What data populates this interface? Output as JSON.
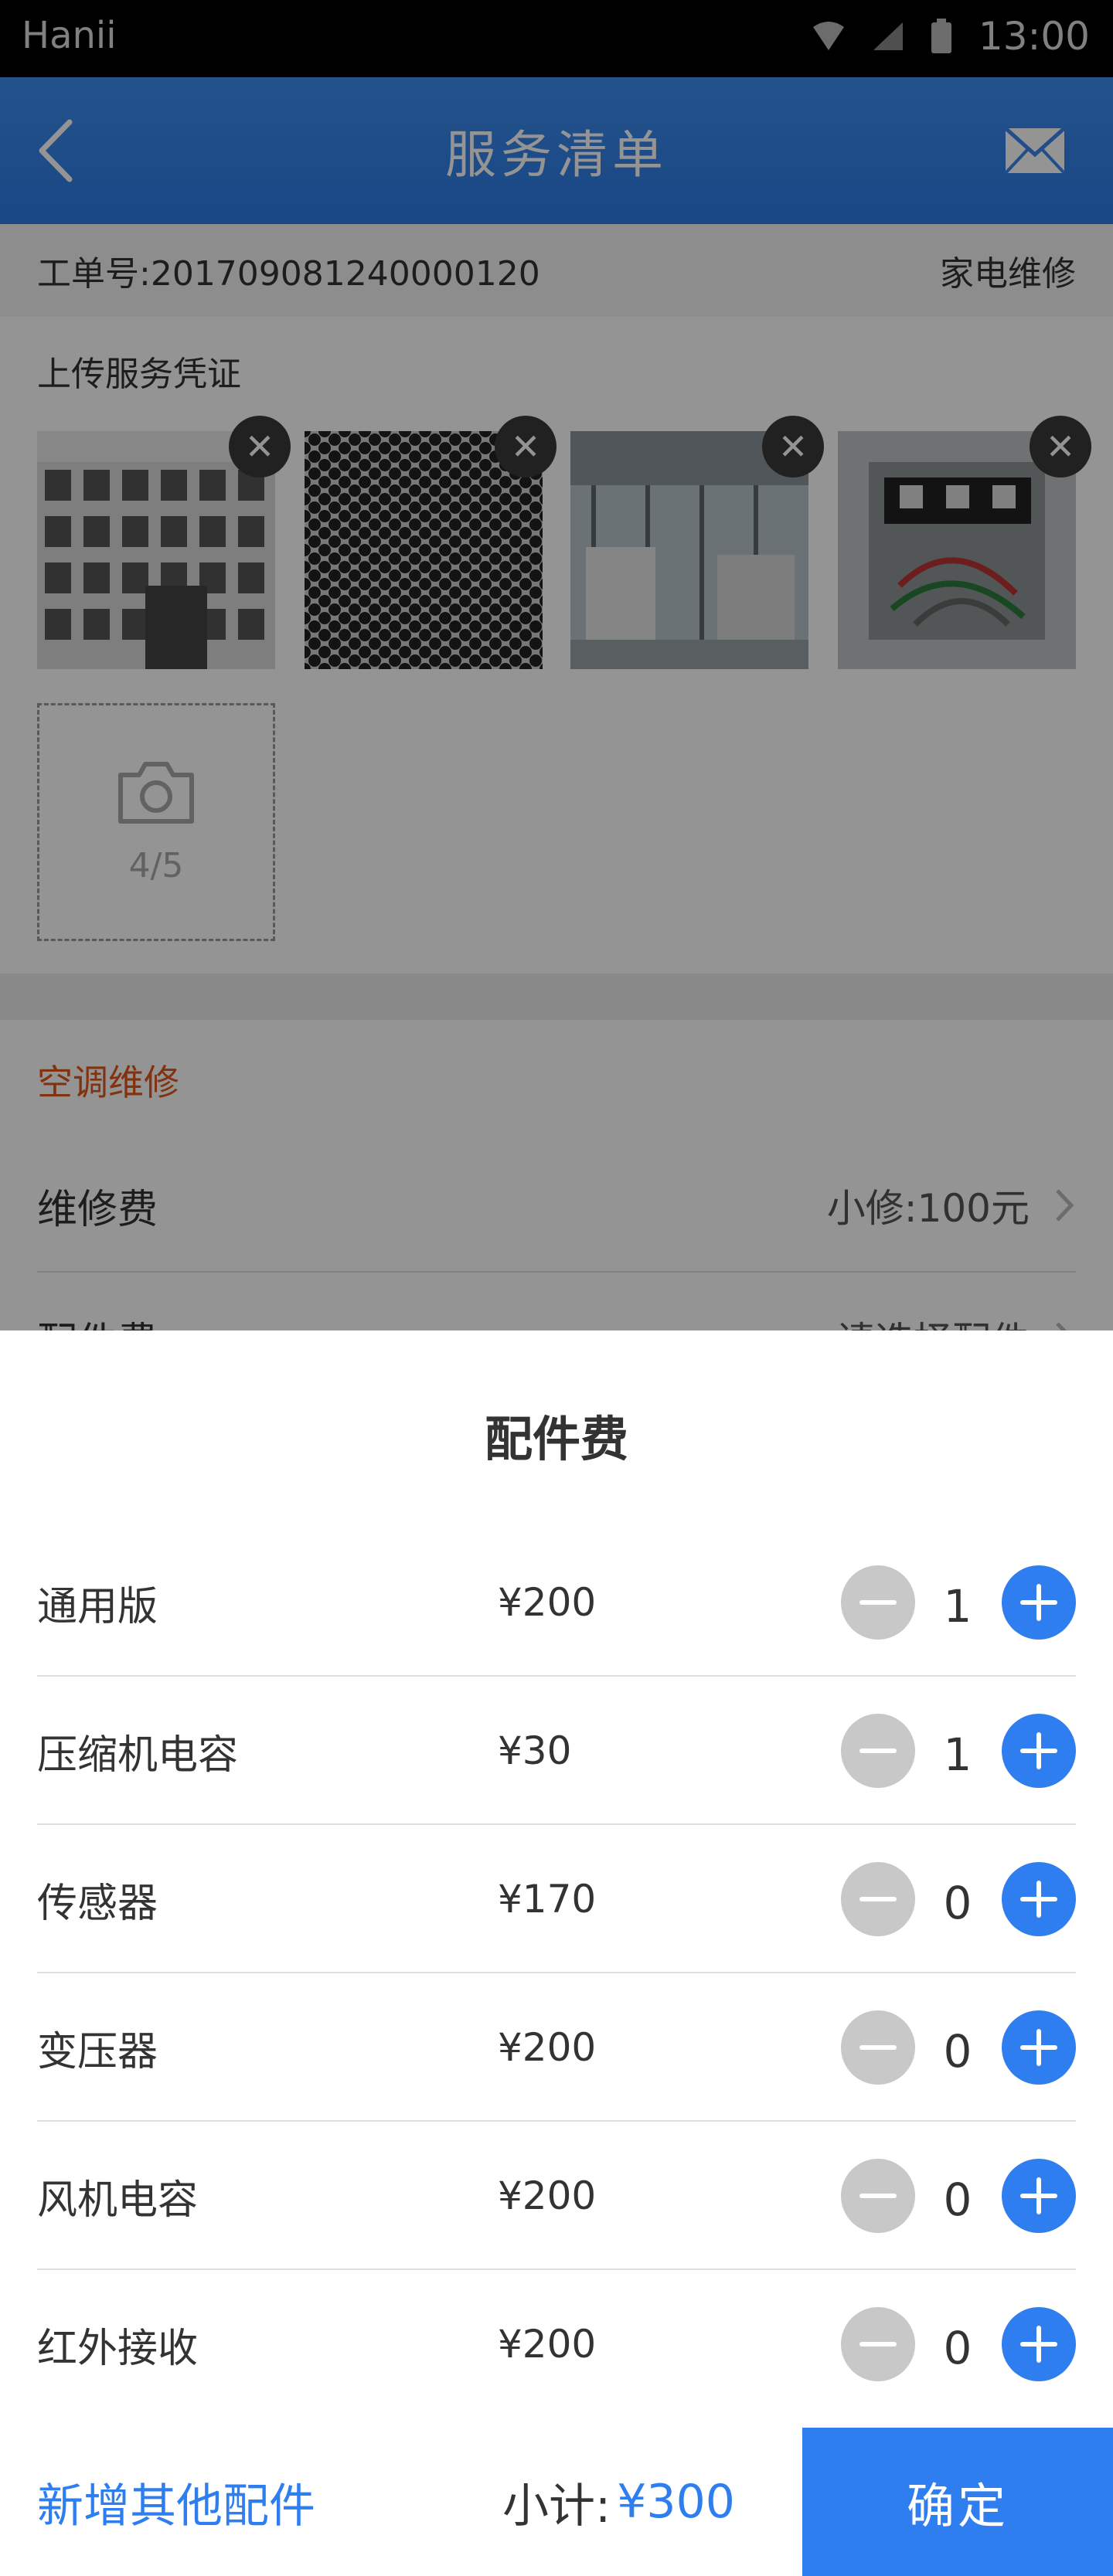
{
  "status_bar": {
    "carrier": "Hanii",
    "time": "13:00"
  },
  "nav": {
    "title": "服务清单"
  },
  "order": {
    "label": "工单号:",
    "number": "201709081240000120",
    "type": "家电维修"
  },
  "upload": {
    "title": "上传服务凭证",
    "photo_count": "4/5",
    "close_glyph": "✕",
    "photos": [
      "building-facade",
      "perforated-metal",
      "ac-units-storefront",
      "electrical-box"
    ]
  },
  "category": {
    "label": "空调维修"
  },
  "fees": [
    {
      "label": "维修费",
      "value": "小修:100元"
    },
    {
      "label": "配件费",
      "value": "请选择配件"
    }
  ],
  "sheet": {
    "title": "配件费",
    "parts": [
      {
        "name": "通用版",
        "price": "¥200",
        "qty": "1"
      },
      {
        "name": "压缩机电容",
        "price": "¥30",
        "qty": "1"
      },
      {
        "name": "传感器",
        "price": "¥170",
        "qty": "0"
      },
      {
        "name": "变压器",
        "price": "¥200",
        "qty": "0"
      },
      {
        "name": "风机电容",
        "price": "¥200",
        "qty": "0"
      },
      {
        "name": "红外接收",
        "price": "¥200",
        "qty": "0"
      }
    ]
  },
  "footer": {
    "add_other": "新增其他配件",
    "subtotal_label": "小计:",
    "subtotal_value": "¥300",
    "confirm": "确定"
  },
  "colors": {
    "accent": "#2f7ef0",
    "category": "#e2571a",
    "minus": "#c8c8c8"
  }
}
